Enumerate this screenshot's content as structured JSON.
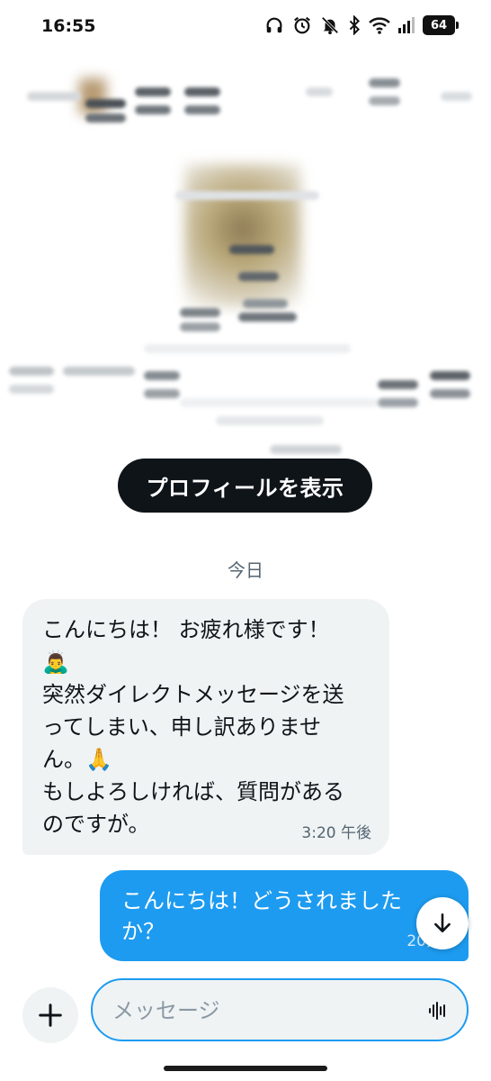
{
  "status_bar": {
    "time": "16:55",
    "battery": "64",
    "icons": [
      "headphones-icon",
      "alarm-icon",
      "bell-off-icon",
      "bluetooth-icon",
      "wifi-icon",
      "signal-icon",
      "battery-icon"
    ]
  },
  "profile": {
    "view_profile_label": "プロフィールを表示"
  },
  "conversation": {
    "date_label": "今日",
    "messages": [
      {
        "direction": "incoming",
        "text": "こんにちは！ お疲れ様です！\n🙇‍♂️\n突然ダイレクトメッセージを送\nってしまい、申し訳ありませ\nん。🙏\nもしよろしければ、質問がある\nのですが。",
        "time": "3:20 午後"
      },
      {
        "direction": "outgoing",
        "text": "こんにちは！どうされました\nか？",
        "time": "20分"
      }
    ]
  },
  "composer": {
    "placeholder": "メッセージ",
    "value": ""
  },
  "colors": {
    "accent": "#1d9bf0",
    "incoming_bubble": "#eff3f4",
    "primary_button": "#0f1419"
  }
}
